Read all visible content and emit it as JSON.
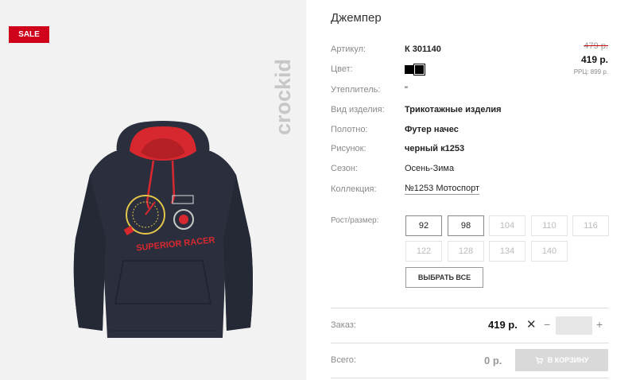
{
  "product": {
    "title": "Джемпер",
    "sale_badge": "SALE",
    "brand": "crockid"
  },
  "details": [
    {
      "label": "Артикул:",
      "value": "К 301140"
    },
    {
      "label": "Цвет:",
      "value": ""
    },
    {
      "label": "Утеплитель:",
      "value": "\""
    },
    {
      "label": "Вид изделия:",
      "value": "Трикотажные изделия"
    },
    {
      "label": "Полотно:",
      "value": "Футер начес"
    },
    {
      "label": "Рисунок:",
      "value": "черный к1253"
    },
    {
      "label": "Сезон:",
      "value": "Осень-Зима"
    },
    {
      "label": "Коллекция:",
      "value": "№1253 Мотоспорт"
    }
  ],
  "colors": [
    "#000000",
    "#000000"
  ],
  "price": {
    "old": "479 р.",
    "new": "419 р.",
    "rrp": "РРЦ: 899 р."
  },
  "sizes": {
    "label": "Рост/размер:",
    "options": [
      {
        "value": "92",
        "available": true
      },
      {
        "value": "98",
        "available": true
      },
      {
        "value": "104",
        "available": false
      },
      {
        "value": "110",
        "available": false
      },
      {
        "value": "116",
        "available": false
      },
      {
        "value": "122",
        "available": false
      },
      {
        "value": "128",
        "available": false
      },
      {
        "value": "134",
        "available": false
      },
      {
        "value": "140",
        "available": false
      }
    ],
    "select_all": "ВЫБРАТЬ ВСЕ"
  },
  "order": {
    "label": "Заказ:",
    "price": "419 р.",
    "times": "✕",
    "minus": "−",
    "plus": "+",
    "quantity": ""
  },
  "total": {
    "label": "Всего:",
    "value": "0 р.",
    "cart_button": "В КОРЗИНУ"
  },
  "print_text": "SUPERIOR RACER"
}
